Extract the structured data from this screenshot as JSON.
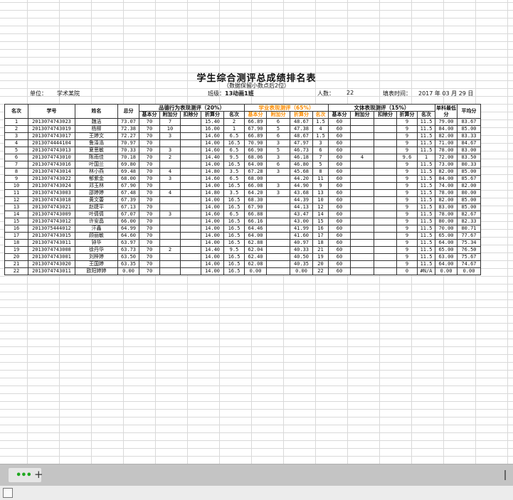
{
  "report": {
    "title": "学生综合测评总成绩排名表",
    "subtitle": "（数据保留小数点后2位）",
    "unit_label": "单位：",
    "unit_value": "学术某院",
    "class_label": "班级：",
    "class_value": "13动画1班",
    "count_label": "人数：",
    "count_value": "22",
    "date_label": "填表时间：",
    "date_value": "2017 年 03 月 29 日"
  },
  "headers": {
    "rank": "名次",
    "student_id": "学号",
    "name": "姓名",
    "total": "总分",
    "group_conduct": "品德行为表现测评（20%）",
    "group_study": "学业表现测评（65%）",
    "group_sport": "文体表现测评（15%）",
    "base": "基本分",
    "bonus": "附加分",
    "deduct": "扣除分",
    "converted": "折算分",
    "rank_sub": "名次",
    "single_low": "单科最低分",
    "average": "平均分"
  },
  "rows": [
    [
      "1",
      "2013074743023",
      "魏洁",
      "73.07",
      "70",
      "7",
      "",
      "15.40",
      "2",
      "66.89",
      "6",
      "48.67",
      "1.5",
      "60",
      "",
      "",
      "9",
      "11.5",
      "79.00",
      "83.67"
    ],
    [
      "2",
      "2013074743019",
      "杨柳",
      "72.38",
      "70",
      "10",
      "",
      "16.00",
      "1",
      "67.90",
      "5",
      "47.38",
      "4",
      "60",
      "",
      "",
      "9",
      "11.5",
      "84.00",
      "85.00"
    ],
    [
      "3",
      "2013074743017",
      "王婷文",
      "72.27",
      "70",
      "3",
      "",
      "14.60",
      "6.5",
      "66.89",
      "6",
      "48.67",
      "1.5",
      "60",
      "",
      "",
      "9",
      "11.5",
      "82.00",
      "83.33"
    ],
    [
      "4",
      "2013074444104",
      "鲁泽浩",
      "70.97",
      "70",
      "",
      "",
      "14.00",
      "16.5",
      "70.90",
      "3",
      "47.97",
      "3",
      "60",
      "",
      "",
      "9",
      "11.5",
      "71.00",
      "84.67"
    ],
    [
      "5",
      "2013074743013",
      "夏思敏",
      "70.33",
      "70",
      "3",
      "",
      "14.60",
      "6.5",
      "66.90",
      "5",
      "46.73",
      "6",
      "60",
      "",
      "",
      "9",
      "11.5",
      "78.00",
      "83.00"
    ],
    [
      "6",
      "2013074743010",
      "陈雨佳",
      "70.18",
      "70",
      "2",
      "",
      "14.40",
      "9.5",
      "68.06",
      "3",
      "46.18",
      "7",
      "60",
      "4",
      "",
      "9.6",
      "1",
      "72.00",
      "83.50"
    ],
    [
      "7",
      "2013074743016",
      "叶国兰",
      "69.80",
      "70",
      "",
      "",
      "14.00",
      "16.5",
      "64.00",
      "6",
      "46.80",
      "5",
      "60",
      "",
      "",
      "9",
      "11.5",
      "73.00",
      "80.33"
    ],
    [
      "8",
      "2013074743014",
      "林小燕",
      "69.48",
      "70",
      "4",
      "",
      "14.80",
      "3.5",
      "67.28",
      "3",
      "45.68",
      "8",
      "60",
      "",
      "",
      "9",
      "11.5",
      "82.00",
      "85.00"
    ],
    [
      "9",
      "2013074743022",
      "郁紫金",
      "68.00",
      "70",
      "3",
      "",
      "14.60",
      "6.5",
      "68.00",
      "",
      "44.20",
      "11",
      "60",
      "",
      "",
      "9",
      "11.5",
      "84.00",
      "85.67"
    ],
    [
      "10",
      "2013074743024",
      "邓玉林",
      "67.90",
      "70",
      "",
      "",
      "14.00",
      "16.5",
      "66.08",
      "3",
      "44.90",
      "9",
      "60",
      "",
      "",
      "9",
      "11.5",
      "74.00",
      "82.00"
    ],
    [
      "11",
      "2013074743003",
      "邵婷婷",
      "67.48",
      "70",
      "4",
      "",
      "14.80",
      "3.5",
      "64.20",
      "3",
      "43.68",
      "13",
      "60",
      "",
      "",
      "9",
      "11.5",
      "78.00",
      "80.00"
    ],
    [
      "12",
      "2013074743018",
      "黄文蕾",
      "67.39",
      "70",
      "",
      "",
      "14.00",
      "16.5",
      "68.30",
      "",
      "44.39",
      "10",
      "60",
      "",
      "",
      "9",
      "11.5",
      "82.00",
      "85.00"
    ],
    [
      "13",
      "2013074743021",
      "赵婕平",
      "67.13",
      "70",
      "",
      "",
      "14.00",
      "16.5",
      "67.90",
      "",
      "44.13",
      "12",
      "60",
      "",
      "",
      "9",
      "11.5",
      "83.00",
      "85.00"
    ],
    [
      "14",
      "2013074743009",
      "叶倩倩",
      "67.07",
      "70",
      "3",
      "",
      "14.60",
      "6.5",
      "66.88",
      "",
      "43.47",
      "14",
      "60",
      "",
      "",
      "9",
      "11.5",
      "78.00",
      "82.67"
    ],
    [
      "15",
      "2013074743012",
      "许安晶",
      "66.00",
      "70",
      "",
      "",
      "14.00",
      "16.5",
      "66.16",
      "",
      "43.00",
      "15",
      "60",
      "",
      "",
      "9",
      "11.5",
      "80.00",
      "82.33"
    ],
    [
      "16",
      "2013075444012",
      "汗鑫",
      "64.99",
      "70",
      "",
      "",
      "14.00",
      "16.5",
      "64.46",
      "",
      "41.99",
      "16",
      "60",
      "",
      "",
      "9",
      "11.5",
      "70.00",
      "80.71"
    ],
    [
      "17",
      "2013074743015",
      "顾丽敏",
      "64.60",
      "70",
      "",
      "",
      "14.00",
      "16.5",
      "64.00",
      "",
      "41.60",
      "17",
      "60",
      "",
      "",
      "9",
      "11.5",
      "65.00",
      "77.67"
    ],
    [
      "18",
      "2013074743011",
      "钟华",
      "63.97",
      "70",
      "",
      "",
      "14.00",
      "16.5",
      "62.88",
      "",
      "40.97",
      "18",
      "60",
      "",
      "",
      "9",
      "11.5",
      "64.00",
      "75.34"
    ],
    [
      "19",
      "2013074743008",
      "徐丹华",
      "63.73",
      "70",
      "2",
      "",
      "14.40",
      "9.5",
      "62.04",
      "",
      "40.33",
      "21",
      "60",
      "",
      "",
      "9",
      "11.5",
      "65.00",
      "76.50"
    ],
    [
      "20",
      "2013074743001",
      "刘梓婷",
      "63.50",
      "70",
      "",
      "",
      "14.00",
      "16.5",
      "62.40",
      "",
      "40.50",
      "19",
      "60",
      "",
      "",
      "9",
      "11.5",
      "63.00",
      "75.67"
    ],
    [
      "21",
      "2013074743020",
      "王国婷",
      "63.35",
      "70",
      "",
      "",
      "14.00",
      "16.5",
      "62.08",
      "",
      "40.35",
      "20",
      "60",
      "",
      "",
      "9",
      "11.5",
      "64.00",
      "74.67"
    ],
    [
      "22",
      "2013074743011",
      "欧阳婷婷",
      "0.00",
      "70",
      "",
      "",
      "14.00",
      "16.5",
      "0.00",
      "",
      "0.00",
      "22",
      "60",
      "",
      "",
      "0",
      "#N/A",
      "0.00",
      "0.00"
    ]
  ],
  "status": {
    "add_sheet": "+",
    "tab_dots": "•••"
  }
}
